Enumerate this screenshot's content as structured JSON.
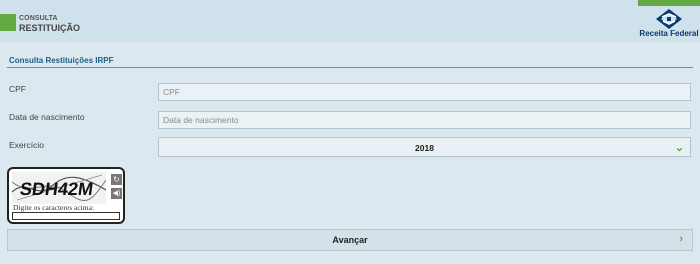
{
  "header": {
    "system_small": "CONSULTA",
    "system_title": "RESTITUIÇÃO",
    "logo_text": "Receita Federal"
  },
  "section": {
    "title": "Consulta Restituições IRPF"
  },
  "form": {
    "cpf": {
      "label": "CPF",
      "placeholder": "CPF",
      "value": ""
    },
    "birth": {
      "label": "Data de nascimento",
      "placeholder": "Data de nascimento",
      "value": ""
    },
    "exercise": {
      "label": "Exercício",
      "selected": "2018"
    }
  },
  "captcha": {
    "text": "SDH42M",
    "hint": "Digite os caracteres acima:",
    "reload_icon": "reload-icon",
    "audio_icon": "audio-icon"
  },
  "actions": {
    "submit_label": "Avançar"
  },
  "colors": {
    "accent_green": "#61a941",
    "header_bg": "#cfe1ea",
    "page_bg": "#dbe8ef",
    "title_blue": "#1d5f85"
  }
}
